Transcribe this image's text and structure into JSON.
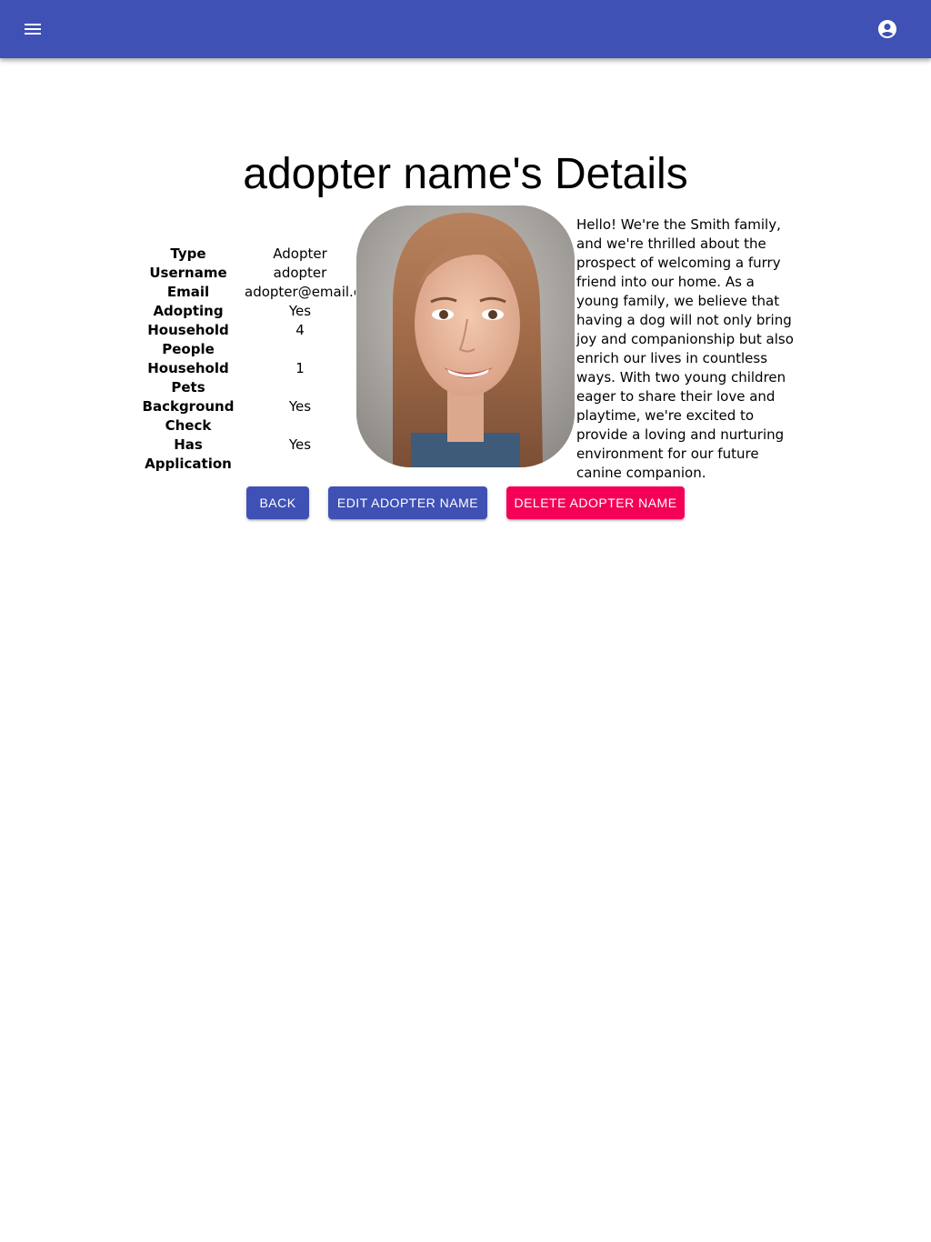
{
  "colors": {
    "primary": "#3f51b5",
    "secondary": "#f50057",
    "text": "#000000"
  },
  "appbar": {
    "menu_icon": "menu-icon",
    "account_icon": "account-circle-icon"
  },
  "page": {
    "title": "adopter name's Details"
  },
  "details": [
    {
      "label": "Type",
      "value": "Adopter"
    },
    {
      "label": "Username",
      "value": "adopter"
    },
    {
      "label": "Email",
      "value": "adopter@email.com"
    },
    {
      "label": "Adopting",
      "value": "Yes"
    },
    {
      "label": "Household People",
      "value": "4"
    },
    {
      "label": "Household Pets",
      "value": "1"
    },
    {
      "label": "Background Check",
      "value": "Yes"
    },
    {
      "label": "Has Application",
      "value": "Yes"
    }
  ],
  "bio": "Hello! We're the Smith family, and we're thrilled about the prospect of welcoming a furry friend into our home. As a young family, we believe that having a dog will not only bring joy and companionship but also enrich our lives in countless ways. With two young children eager to share their love and playtime, we're excited to provide a loving and nurturing environment for our future canine companion.",
  "actions": {
    "back": "BACK",
    "edit": "EDIT ADOPTER NAME",
    "delete": "DELETE ADOPTER NAME"
  }
}
